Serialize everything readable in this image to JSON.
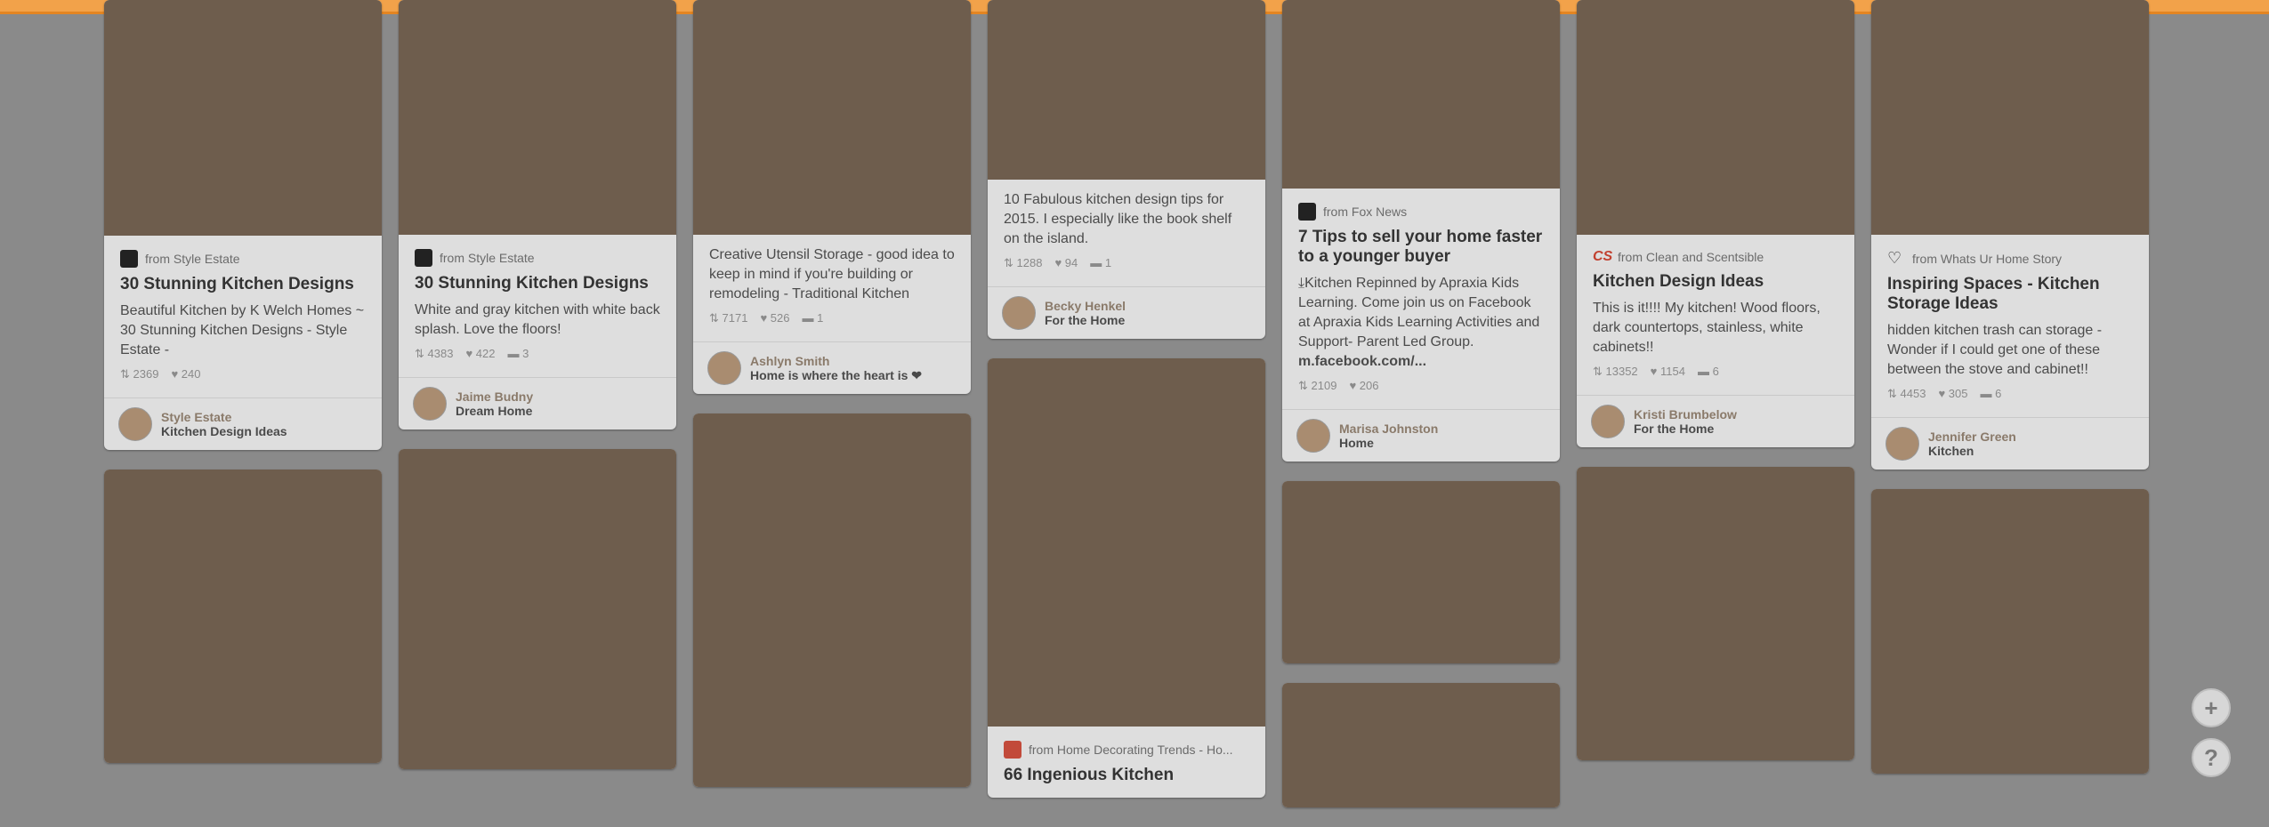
{
  "ui": {
    "plus_label": "+",
    "help_label": "?"
  },
  "cols": [
    {
      "pins": [
        {
          "source": "from Style Estate",
          "title": "30 Stunning Kitchen Designs",
          "desc": "Beautiful Kitchen by K Welch Homes ~ 30 Stunning Kitchen Designs - Style Estate -",
          "repins": "2369",
          "likes": "240",
          "comments": "",
          "owner_name": "Style Estate",
          "owner_board": "Kitchen Design Ideas"
        }
      ]
    },
    {
      "pins": [
        {
          "source": "from Style Estate",
          "title": "30 Stunning Kitchen Designs",
          "desc": "White and gray kitchen with white back splash. Love the floors!",
          "repins": "4383",
          "likes": "422",
          "comments": "3",
          "owner_name": "Jaime Budny",
          "owner_board": "Dream Home"
        }
      ]
    },
    {
      "pins": [
        {
          "desc": "Creative Utensil Storage - good idea to keep in mind if you're building or remodeling - Traditional Kitchen",
          "repins": "7171",
          "likes": "526",
          "comments": "1",
          "owner_name": "Ashlyn Smith",
          "owner_board": "Home is where the heart is ❤"
        }
      ]
    },
    {
      "pins": [
        {
          "desc": "10 Fabulous kitchen design tips for 2015. I especially like the book shelf on the island.",
          "repins": "1288",
          "likes": "94",
          "comments": "1",
          "owner_name": "Becky Henkel",
          "owner_board": "For the Home"
        },
        {
          "source": "from Home Decorating Trends - Ho...",
          "title": "66 Ingenious Kitchen"
        }
      ]
    },
    {
      "pins": [
        {
          "source": "from Fox News",
          "title": "7 Tips to sell your home faster to a younger buyer",
          "desc": "⤓Kitchen Repinned by Apraxia Kids Learning. Come join us on Facebook at Apraxia Kids Learning Activities and Support- Parent Led Group.",
          "desc_link": "m.facebook.com/...",
          "repins": "2109",
          "likes": "206",
          "comments": "",
          "owner_name": "Marisa Johnston",
          "owner_board": "Home"
        }
      ]
    },
    {
      "pins": [
        {
          "source": "from Clean and Scentsible",
          "title": "Kitchen Design Ideas",
          "desc": "This is it!!!! My kitchen! Wood floors, dark countertops, stainless, white cabinets!!",
          "repins": "13352",
          "likes": "1154",
          "comments": "6",
          "owner_name": "Kristi Brumbelow",
          "owner_board": "For the Home"
        }
      ]
    },
    {
      "pins": [
        {
          "source": "from Whats Ur Home Story",
          "title": "Inspiring Spaces - Kitchen Storage Ideas",
          "desc": "hidden kitchen trash can storage - Wonder if I could get one of these between the stove and cabinet!!",
          "repins": "4453",
          "likes": "305",
          "comments": "6",
          "owner_name": "Jennifer Green",
          "owner_board": "Kitchen"
        }
      ]
    }
  ]
}
